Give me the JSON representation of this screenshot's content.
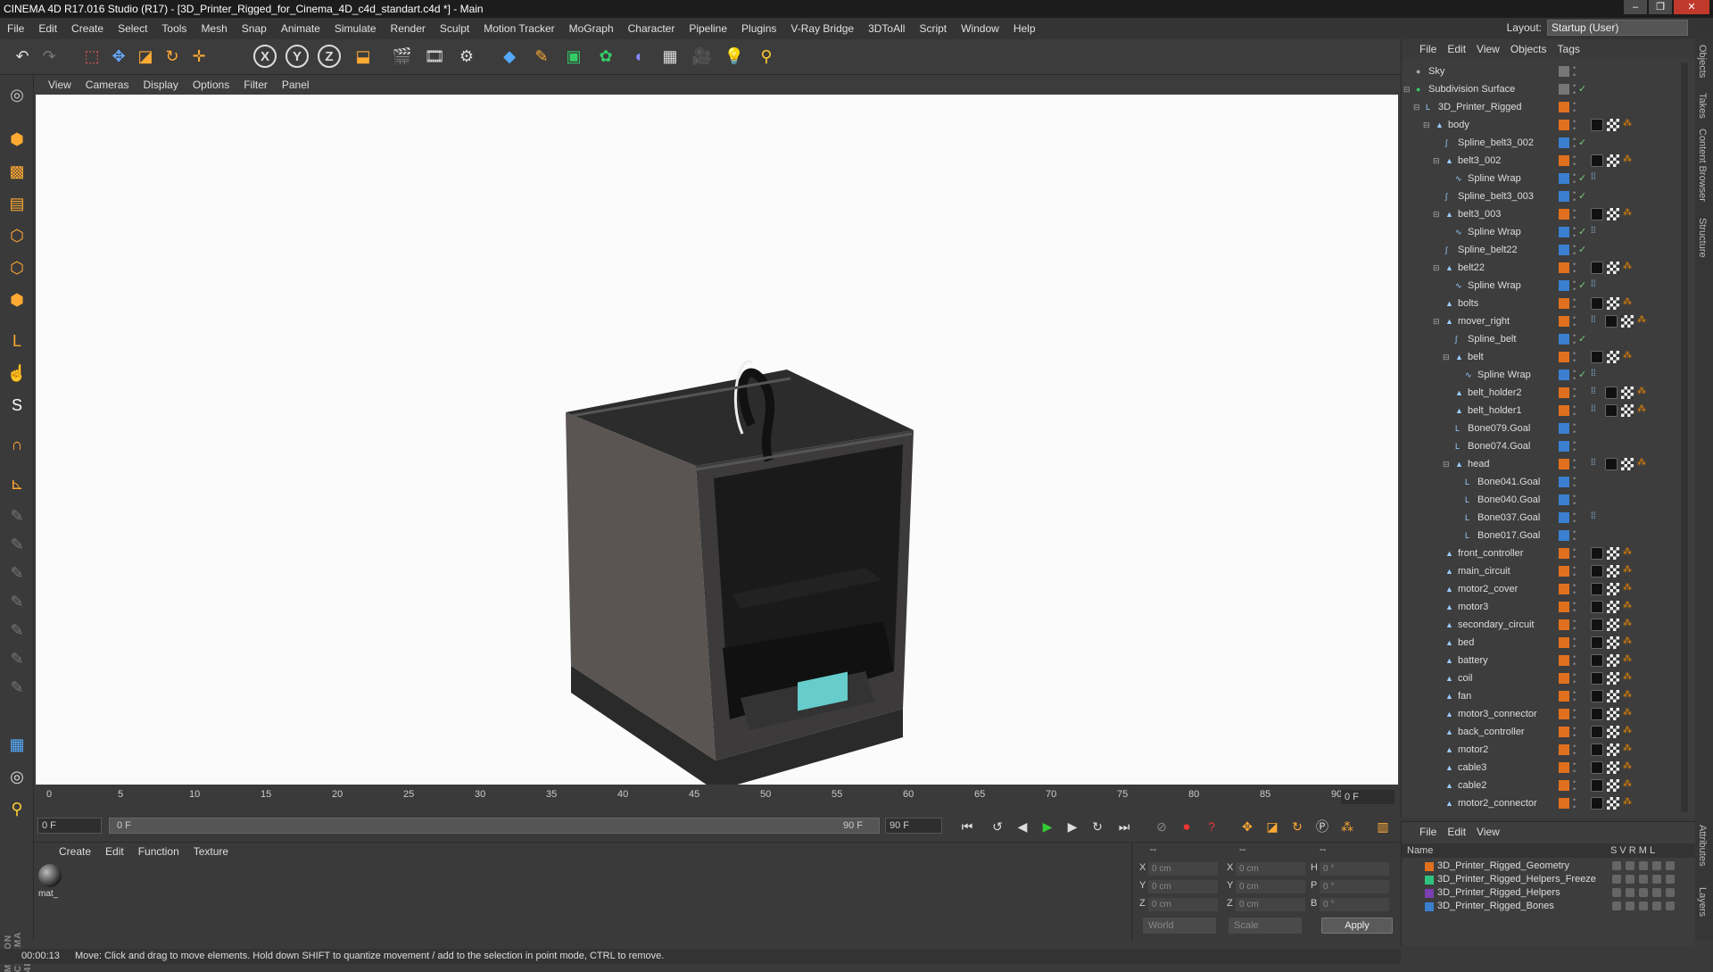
{
  "title": "CINEMA 4D R17.016 Studio (R17) - [3D_Printer_Rigged_for_Cinema_4D_c4d_standart.c4d *] - Main",
  "menu": [
    "File",
    "Edit",
    "Create",
    "Select",
    "Tools",
    "Mesh",
    "Snap",
    "Animate",
    "Simulate",
    "Render",
    "Sculpt",
    "Motion Tracker",
    "MoGraph",
    "Character",
    "Pipeline",
    "Plugins",
    "V-Ray Bridge",
    "3DToAll",
    "Script",
    "Window",
    "Help"
  ],
  "layout": {
    "label": "Layout:",
    "value": "Startup (User)"
  },
  "viewport_menu": [
    "View",
    "Cameras",
    "Display",
    "Options",
    "Filter",
    "Panel"
  ],
  "timeline": {
    "ticks": [
      "0",
      "5",
      "10",
      "15",
      "20",
      "25",
      "30",
      "35",
      "40",
      "45",
      "50",
      "55",
      "60",
      "65",
      "70",
      "75",
      "80",
      "85",
      "90"
    ],
    "frame_field": "0 F",
    "start": "0 F",
    "slider_start": "0 F",
    "slider_end": "90 F",
    "end": "90 F"
  },
  "material_menu": [
    "Create",
    "Edit",
    "Function",
    "Texture"
  ],
  "material_label": "mat_",
  "coords": {
    "rows": [
      [
        "X",
        "0 cm",
        "X",
        "0 cm",
        "H",
        "0 °"
      ],
      [
        "Y",
        "0 cm",
        "Y",
        "0 cm",
        "P",
        "0 °"
      ],
      [
        "Z",
        "0 cm",
        "Z",
        "0 cm",
        "B",
        "0 °"
      ]
    ],
    "mode1": "World",
    "mode2": "Scale",
    "apply": "Apply",
    "header": [
      "--",
      "--",
      "--"
    ]
  },
  "status": {
    "time": "00:00:13",
    "message": "Move: Click and drag to move elements. Hold down SHIFT to quantize movement / add to the selection in point mode, CTRL to remove."
  },
  "object_menu": [
    "File",
    "Edit",
    "View",
    "Objects",
    "Tags"
  ],
  "objects": [
    {
      "name": "Sky",
      "indent": 0,
      "icon": "sky",
      "color": "#777",
      "check": false,
      "tags": ""
    },
    {
      "name": "Subdivision Surface",
      "indent": 0,
      "icon": "subdiv",
      "color": "#777",
      "check": true,
      "tags": ""
    },
    {
      "name": "3D_Printer_Rigged",
      "indent": 1,
      "icon": "null",
      "color": "#e0701e",
      "check": false,
      "tags": ""
    },
    {
      "name": "body",
      "indent": 2,
      "icon": "poly",
      "color": "#e0701e",
      "check": false,
      "tags": "bco"
    },
    {
      "name": "Spline_belt3_002",
      "indent": 3,
      "icon": "spline",
      "color": "#3a7fd0",
      "check": true,
      "tags": ""
    },
    {
      "name": "belt3_002",
      "indent": 3,
      "icon": "poly",
      "color": "#e0701e",
      "check": false,
      "tags": "bco"
    },
    {
      "name": "Spline Wrap",
      "indent": 4,
      "icon": "wrap",
      "color": "#3a7fd0",
      "check": true,
      "tags": "d"
    },
    {
      "name": "Spline_belt3_003",
      "indent": 3,
      "icon": "spline",
      "color": "#3a7fd0",
      "check": true,
      "tags": ""
    },
    {
      "name": "belt3_003",
      "indent": 3,
      "icon": "poly",
      "color": "#e0701e",
      "check": false,
      "tags": "bco"
    },
    {
      "name": "Spline Wrap",
      "indent": 4,
      "icon": "wrap",
      "color": "#3a7fd0",
      "check": true,
      "tags": "d"
    },
    {
      "name": "Spline_belt22",
      "indent": 3,
      "icon": "spline",
      "color": "#3a7fd0",
      "check": true,
      "tags": ""
    },
    {
      "name": "belt22",
      "indent": 3,
      "icon": "poly",
      "color": "#e0701e",
      "check": false,
      "tags": "bco"
    },
    {
      "name": "Spline Wrap",
      "indent": 4,
      "icon": "wrap",
      "color": "#3a7fd0",
      "check": true,
      "tags": "d"
    },
    {
      "name": "bolts",
      "indent": 3,
      "icon": "poly",
      "color": "#e0701e",
      "check": false,
      "tags": "bco"
    },
    {
      "name": "mover_right",
      "indent": 3,
      "icon": "poly",
      "color": "#e0701e",
      "check": false,
      "tags": "dbco"
    },
    {
      "name": "Spline_belt",
      "indent": 4,
      "icon": "spline",
      "color": "#3a7fd0",
      "check": true,
      "tags": ""
    },
    {
      "name": "belt",
      "indent": 4,
      "icon": "poly",
      "color": "#e0701e",
      "check": false,
      "tags": "bco"
    },
    {
      "name": "Spline Wrap",
      "indent": 5,
      "icon": "wrap",
      "color": "#3a7fd0",
      "check": true,
      "tags": "d"
    },
    {
      "name": "belt_holder2",
      "indent": 4,
      "icon": "poly",
      "color": "#e0701e",
      "check": false,
      "tags": "dbco"
    },
    {
      "name": "belt_holder1",
      "indent": 4,
      "icon": "poly",
      "color": "#e0701e",
      "check": false,
      "tags": "dbco"
    },
    {
      "name": "Bone079.Goal",
      "indent": 4,
      "icon": "goal",
      "color": "#3a7fd0",
      "check": false,
      "tags": ""
    },
    {
      "name": "Bone074.Goal",
      "indent": 4,
      "icon": "goal",
      "color": "#3a7fd0",
      "check": false,
      "tags": ""
    },
    {
      "name": "head",
      "indent": 4,
      "icon": "poly",
      "color": "#e0701e",
      "check": false,
      "tags": "dbco"
    },
    {
      "name": "Bone041.Goal",
      "indent": 5,
      "icon": "goal",
      "color": "#3a7fd0",
      "check": false,
      "tags": ""
    },
    {
      "name": "Bone040.Goal",
      "indent": 5,
      "icon": "goal",
      "color": "#3a7fd0",
      "check": false,
      "tags": ""
    },
    {
      "name": "Bone037.Goal",
      "indent": 5,
      "icon": "goal",
      "color": "#3a7fd0",
      "check": false,
      "tags": "d"
    },
    {
      "name": "Bone017.Goal",
      "indent": 5,
      "icon": "goal",
      "color": "#3a7fd0",
      "check": false,
      "tags": ""
    },
    {
      "name": "front_controller",
      "indent": 3,
      "icon": "poly",
      "color": "#e0701e",
      "check": false,
      "tags": "bco"
    },
    {
      "name": "main_circuit",
      "indent": 3,
      "icon": "poly",
      "color": "#e0701e",
      "check": false,
      "tags": "bco"
    },
    {
      "name": "motor2_cover",
      "indent": 3,
      "icon": "poly",
      "color": "#e0701e",
      "check": false,
      "tags": "bco"
    },
    {
      "name": "motor3",
      "indent": 3,
      "icon": "poly",
      "color": "#e0701e",
      "check": false,
      "tags": "bco"
    },
    {
      "name": "secondary_circuit",
      "indent": 3,
      "icon": "poly",
      "color": "#e0701e",
      "check": false,
      "tags": "bco"
    },
    {
      "name": "bed",
      "indent": 3,
      "icon": "poly",
      "color": "#e0701e",
      "check": false,
      "tags": "bco"
    },
    {
      "name": "battery",
      "indent": 3,
      "icon": "poly",
      "color": "#e0701e",
      "check": false,
      "tags": "bco"
    },
    {
      "name": "coil",
      "indent": 3,
      "icon": "poly",
      "color": "#e0701e",
      "check": false,
      "tags": "bco"
    },
    {
      "name": "fan",
      "indent": 3,
      "icon": "poly",
      "color": "#e0701e",
      "check": false,
      "tags": "bco"
    },
    {
      "name": "motor3_connector",
      "indent": 3,
      "icon": "poly",
      "color": "#e0701e",
      "check": false,
      "tags": "bco"
    },
    {
      "name": "back_controller",
      "indent": 3,
      "icon": "poly",
      "color": "#e0701e",
      "check": false,
      "tags": "bco"
    },
    {
      "name": "motor2",
      "indent": 3,
      "icon": "poly",
      "color": "#e0701e",
      "check": false,
      "tags": "bco"
    },
    {
      "name": "cable3",
      "indent": 3,
      "icon": "poly",
      "color": "#e0701e",
      "check": false,
      "tags": "bco"
    },
    {
      "name": "cable2",
      "indent": 3,
      "icon": "poly",
      "color": "#e0701e",
      "check": false,
      "tags": "bco"
    },
    {
      "name": "motor2_connector",
      "indent": 3,
      "icon": "poly",
      "color": "#e0701e",
      "check": false,
      "tags": "bco"
    }
  ],
  "layer_menu": [
    "File",
    "Edit",
    "View"
  ],
  "layer_header": {
    "name": "Name",
    "flags": "S V R M L"
  },
  "layers": [
    {
      "name": "3D_Printer_Rigged_Geometry",
      "color": "#e0701e"
    },
    {
      "name": "3D_Printer_Rigged_Helpers_Freeze",
      "color": "#2ec27e"
    },
    {
      "name": "3D_Printer_Rigged_Helpers",
      "color": "#7a3fb0"
    },
    {
      "name": "3D_Printer_Rigged_Bones",
      "color": "#3a7fd0"
    }
  ],
  "side_tabs": [
    "Objects",
    "Takes",
    "Content Browser",
    "Structure"
  ],
  "side_tabs_lower": [
    "Attributes",
    "Layers"
  ]
}
